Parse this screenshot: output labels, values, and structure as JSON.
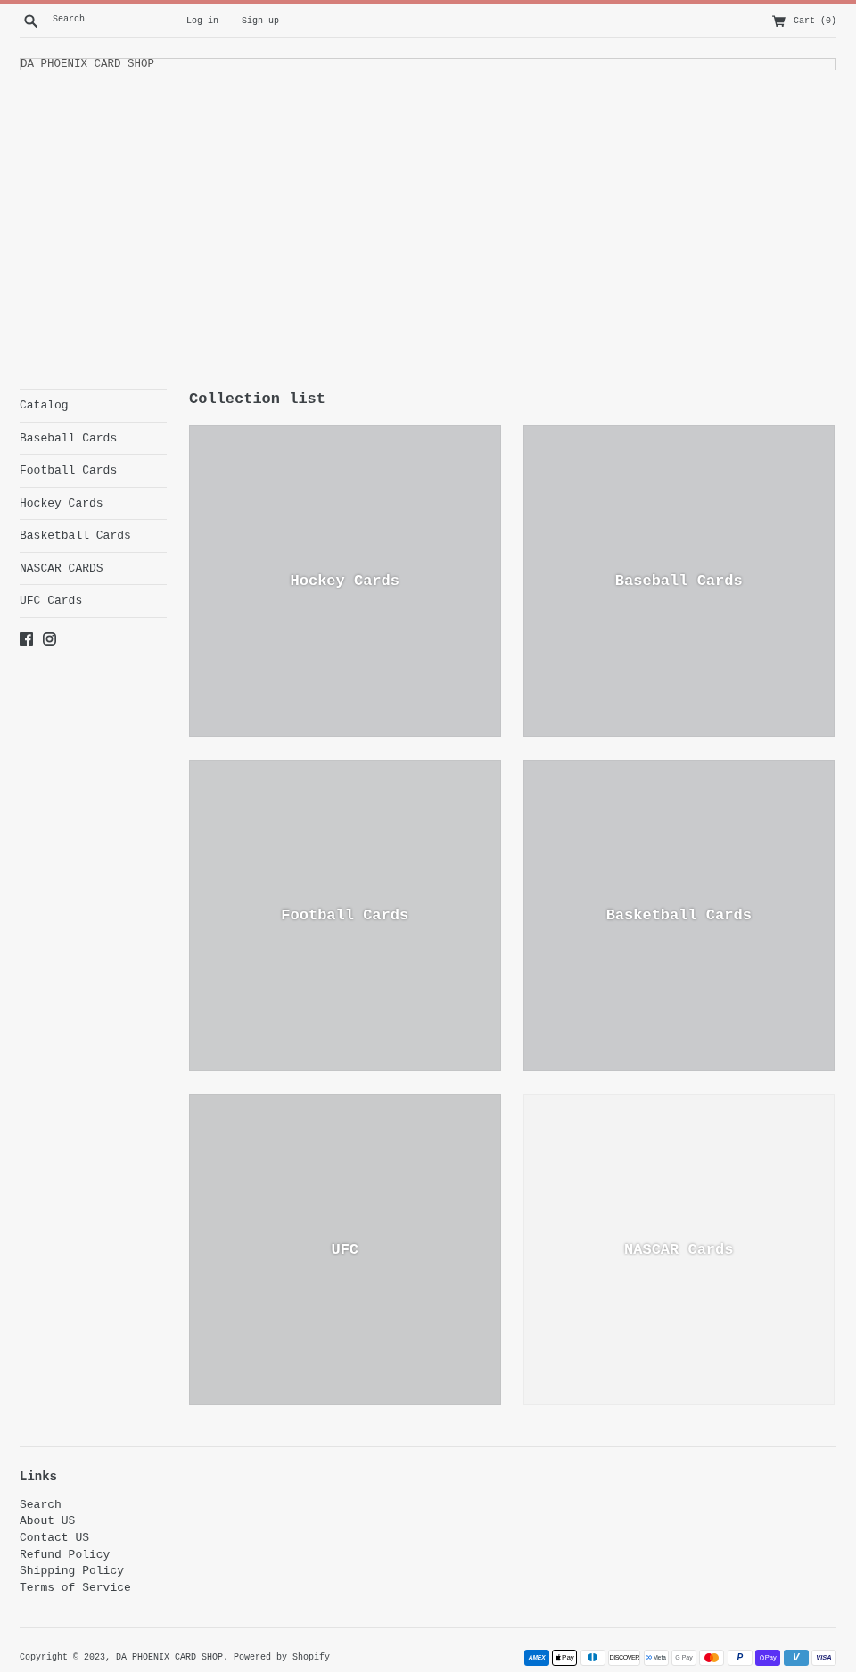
{
  "header": {
    "search": {
      "placeholder": "Search"
    },
    "links": [
      "Log in",
      "Sign up"
    ],
    "cart": "Cart (0)"
  },
  "logo": "DA PHOENIX CARD SHOP",
  "sidebar": {
    "items": [
      "Catalog",
      "Baseball Cards",
      "Football Cards",
      "Hockey Cards",
      "Basketball Cards",
      "NASCAR CARDS",
      "UFC Cards"
    ],
    "social": [
      {
        "kind": "facebook"
      },
      {
        "kind": "instagram"
      }
    ]
  },
  "collection_list": {
    "title": "Collection list",
    "collections": [
      {
        "title": "Hockey Cards",
        "color": "#c9cacc"
      },
      {
        "title": "Baseball Cards",
        "color": "#c9cacc"
      },
      {
        "title": "Football Cards",
        "color": "#cbcccd"
      },
      {
        "title": "Basketball Cards",
        "color": "#c9cacc"
      },
      {
        "title": "UFC",
        "color": "#c9cacb"
      },
      {
        "title": "NASCAR Cards",
        "color": "#f3f3f3"
      }
    ]
  },
  "footer": {
    "heading": "Links",
    "links": [
      "Search",
      "About US",
      "Contact US",
      "Refund Policy",
      "Shipping Policy",
      "Terms of Service"
    ],
    "copyright": "Copyright © 2023, DA PHOENIX CARD SHOP. Powered by Shopify",
    "payment_icons": [
      {
        "kind": "amex",
        "label": "AMEX"
      },
      {
        "kind": "apple_pay",
        "label": "Pay"
      },
      {
        "kind": "diners"
      },
      {
        "kind": "discover",
        "label": "DISCOVER"
      },
      {
        "kind": "meta_pay",
        "label": "Meta"
      },
      {
        "kind": "google_pay",
        "label": "G Pay"
      },
      {
        "kind": "mastercard"
      },
      {
        "kind": "paypal",
        "label": "P"
      },
      {
        "kind": "shop_pay",
        "label": "Pay"
      },
      {
        "kind": "venmo",
        "label": "V"
      },
      {
        "kind": "visa",
        "label": "VISA"
      }
    ]
  }
}
